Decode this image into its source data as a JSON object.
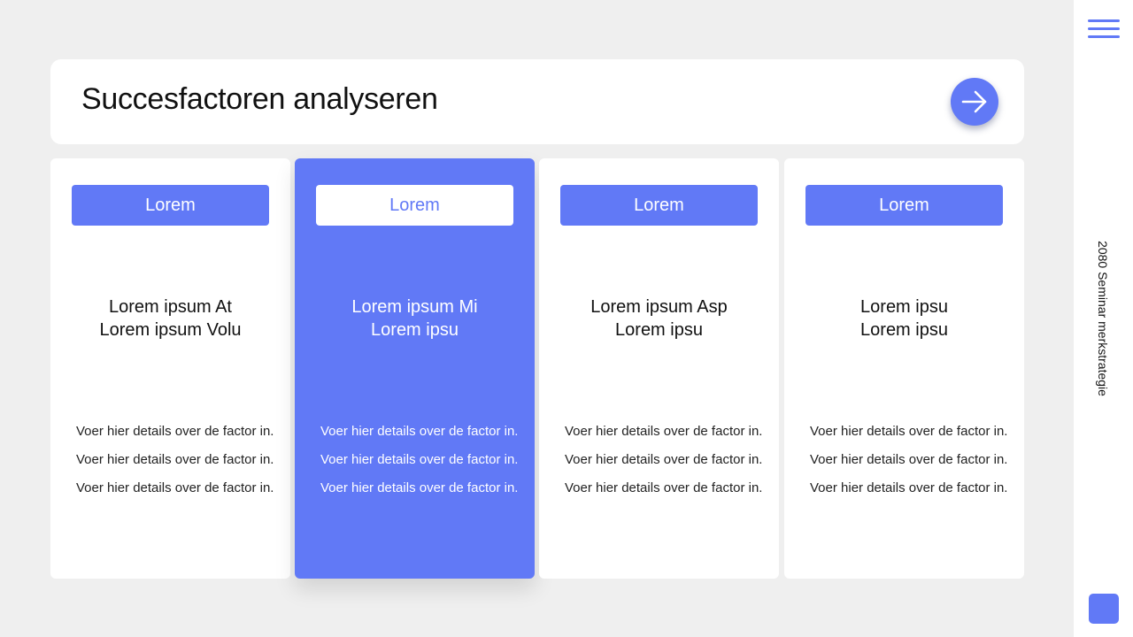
{
  "header": {
    "title": "Succesfactoren analyseren",
    "next_icon": "arrow-right-icon"
  },
  "cards": [
    {
      "tag": "Lorem",
      "title_lines": [
        "Lorem ipsum At",
        "Lorem ipsum Volu"
      ],
      "details": [
        "Voer hier details over de factor in.",
        "Voer hier details over de factor in.",
        "Voer hier details over de factor in."
      ],
      "active": false
    },
    {
      "tag": "Lorem",
      "title_lines": [
        "Lorem ipsum Mi",
        "Lorem ipsu"
      ],
      "details": [
        "Voer hier details over de factor in.",
        "Voer hier details over de factor in.",
        "Voer hier details over de factor in."
      ],
      "active": true
    },
    {
      "tag": "Lorem",
      "title_lines": [
        "Lorem ipsum Asp",
        "Lorem ipsu"
      ],
      "details": [
        "Voer hier details over de factor in.",
        "Voer hier details over de factor in.",
        "Voer hier details over de factor in."
      ],
      "active": false
    },
    {
      "tag": "Lorem",
      "title_lines": [
        "Lorem ipsu",
        "Lorem ipsu"
      ],
      "details": [
        "Voer hier details over de factor in.",
        "Voer hier details over de factor in.",
        "Voer hier details over de factor in."
      ],
      "active": false
    }
  ],
  "sidebar": {
    "label": "2080 Seminar merkstrategie",
    "menu_icon": "hamburger-menu-icon"
  },
  "colors": {
    "accent": "#6179f6",
    "background": "#efefef",
    "card": "#ffffff",
    "text": "#111111"
  }
}
